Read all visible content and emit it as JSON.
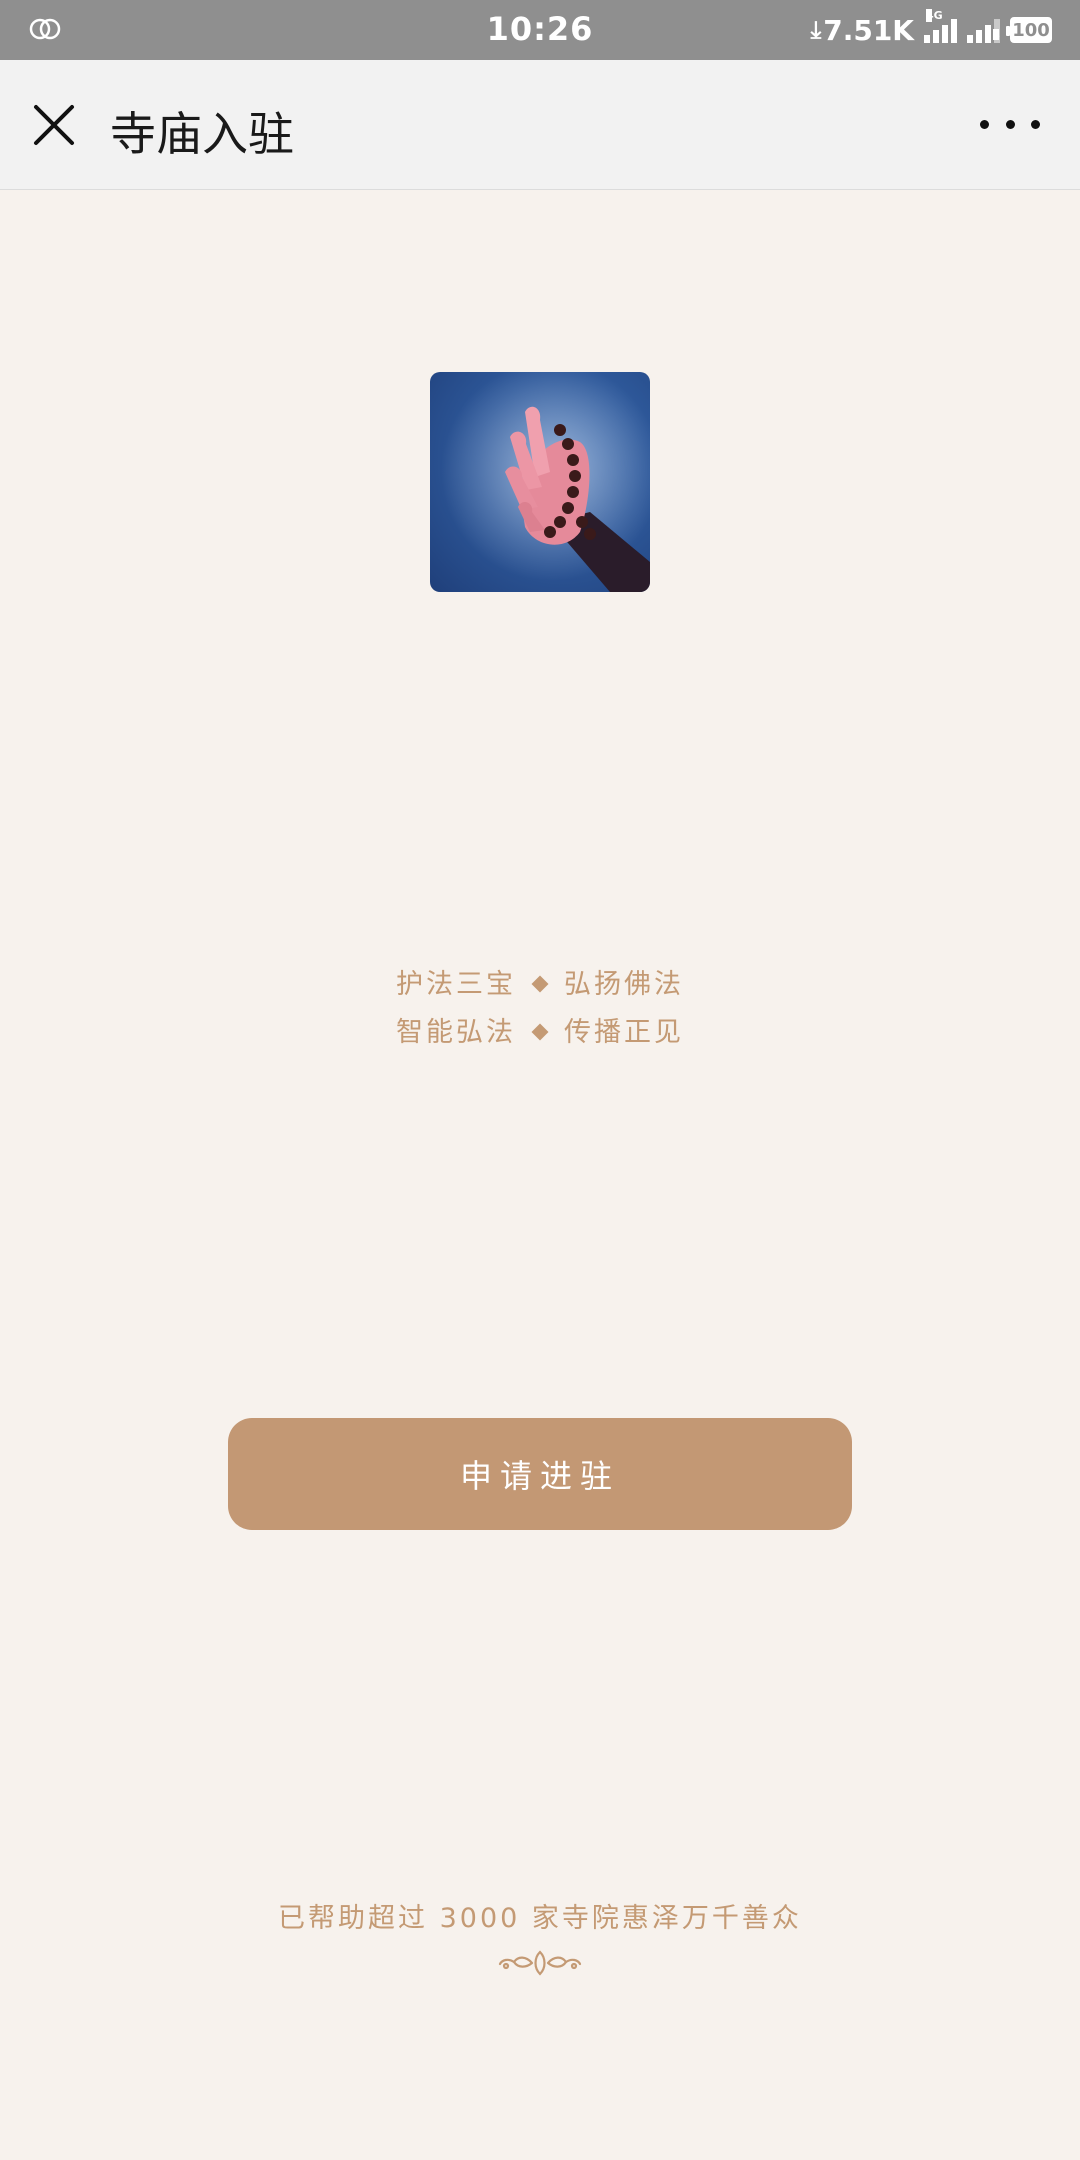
{
  "status_bar": {
    "time": "10:26",
    "net_speed": "7.51K",
    "network_type": "4G",
    "sim2_tag": "2",
    "battery": "100",
    "icons": [
      "link-icon",
      "download-arrow-icon",
      "signal-icon",
      "signal-icon",
      "battery-icon"
    ]
  },
  "nav": {
    "title": "寺庙入驻",
    "close_icon": "close-icon",
    "more_icon": "more-icon"
  },
  "hero": {
    "image_semantic": "hand-with-prayer-beads-image"
  },
  "slogan": {
    "line1_left": "护法三宝",
    "line1_right": "弘扬佛法",
    "line2_left": "智能弘法",
    "line2_right": "传播正见"
  },
  "apply": {
    "label": "申请进驻"
  },
  "footer": {
    "text": "已帮助超过 3000 家寺院惠泽万千善众",
    "ornament_icon": "ornament-icon"
  },
  "colors": {
    "accent": "#c39874",
    "text_accent": "#c49a74",
    "background": "#f7f2ed",
    "status_bar": "#8f8f8f",
    "nav_bar": "#f2f2f2"
  }
}
